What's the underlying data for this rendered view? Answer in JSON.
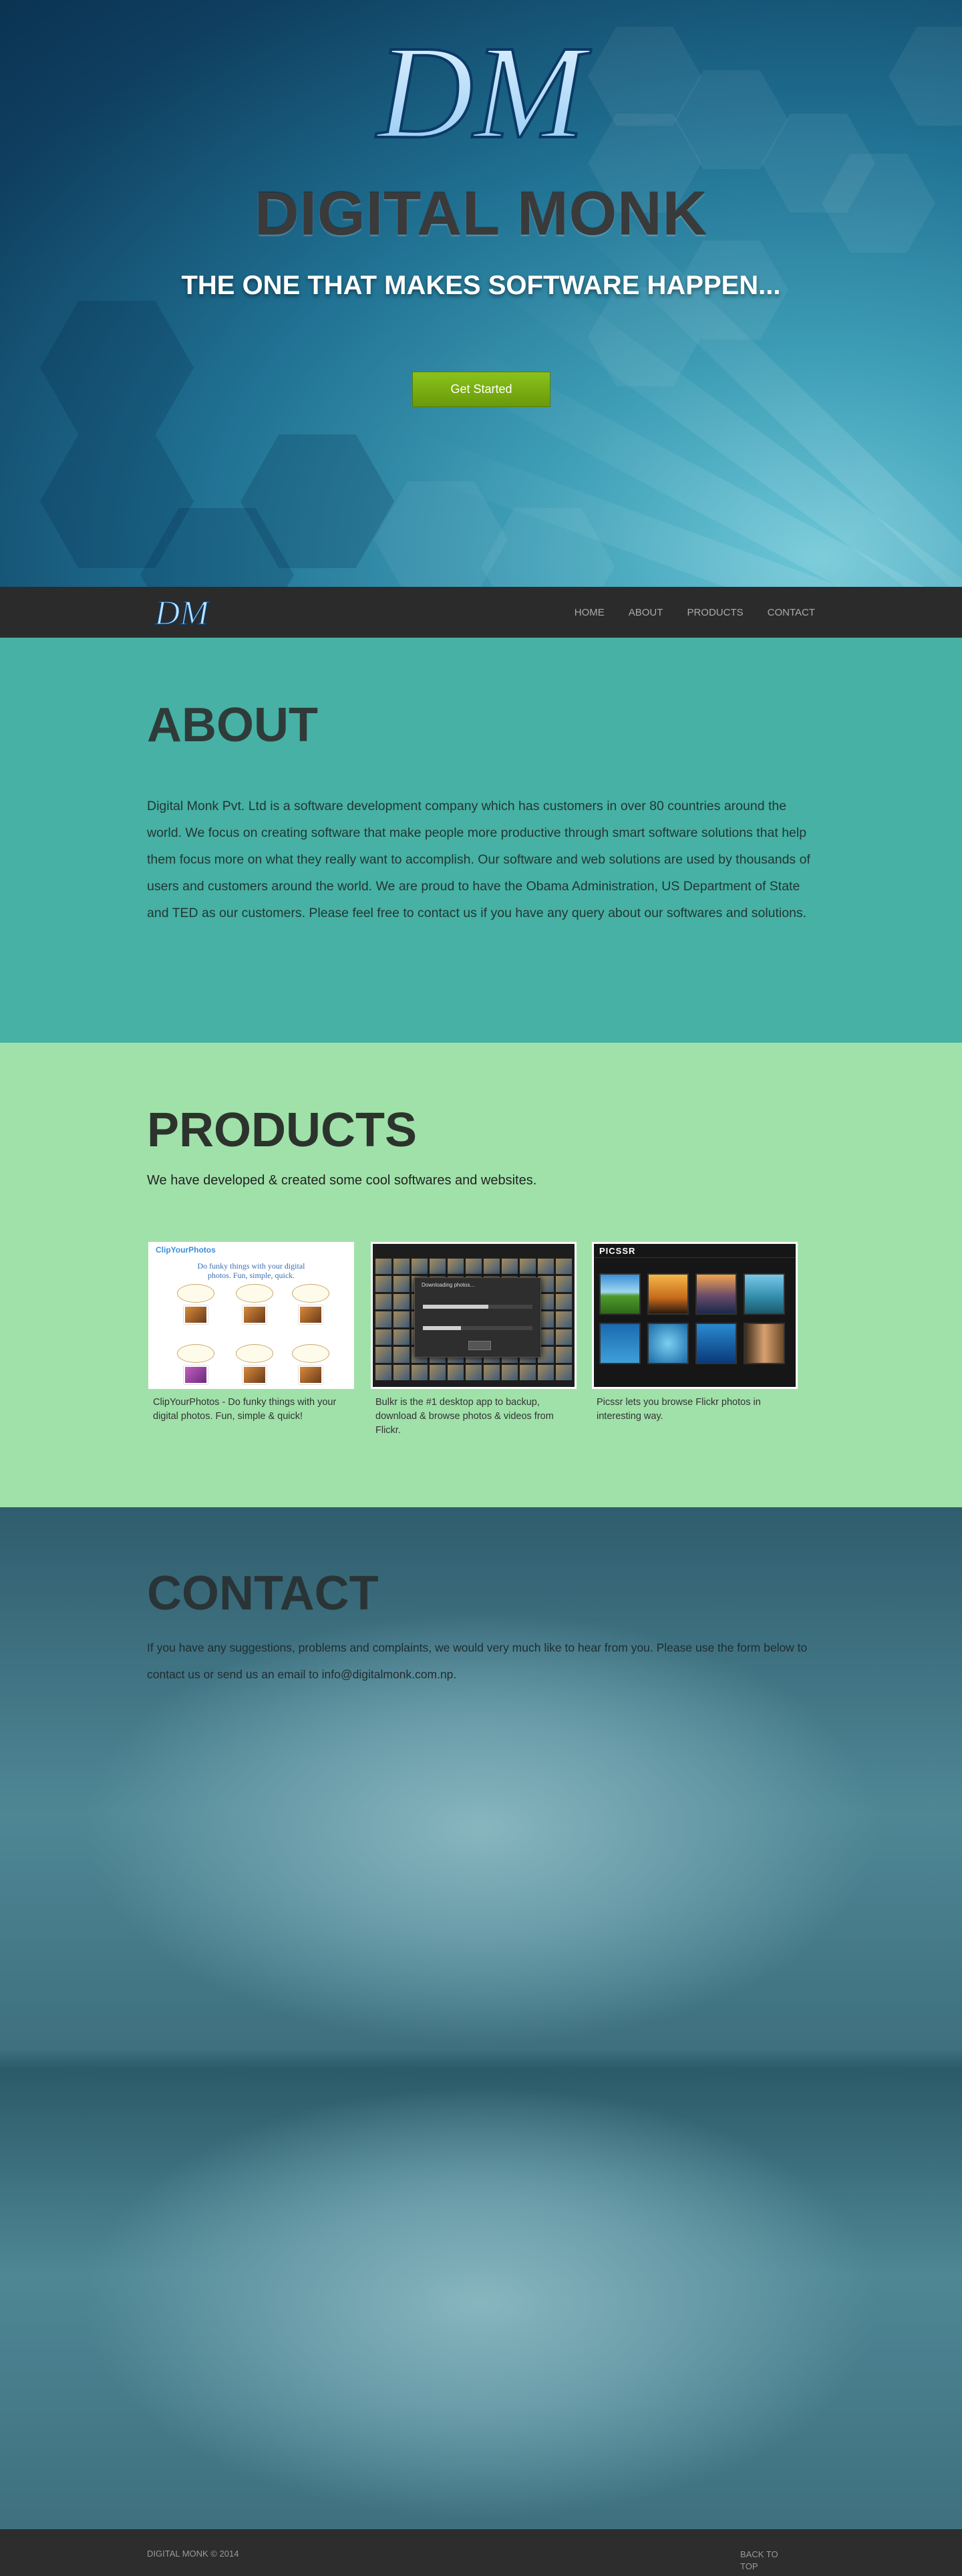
{
  "hero": {
    "logo_monogram": "DM",
    "title": "DIGITAL MONK",
    "tagline": "THE ONE THAT MAKES SOFTWARE HAPPEN...",
    "cta_label": "Get Started",
    "cta_color": "#7aae12"
  },
  "nav": {
    "logo_monogram": "DM",
    "items": [
      {
        "label": "HOME"
      },
      {
        "label": "ABOUT"
      },
      {
        "label": "PRODUCTS"
      },
      {
        "label": "CONTACT"
      }
    ]
  },
  "about": {
    "heading": "ABOUT",
    "body": "Digital Monk Pvt. Ltd is a software development company which has customers in over 80 countries around the world. We focus on creating software that make people more productive through smart software solutions that help them focus more on what they really want to accomplish. Our software and web solutions are used by thousands of users and customers around the world. We are proud to have the Obama Administration, US Department of State and TED as our customers. Please feel free to contact us if you have any query about our softwares and solutions."
  },
  "products": {
    "heading": "PRODUCTS",
    "subheading": "We have developed & created some cool softwares and websites.",
    "items": [
      {
        "caption": "ClipYourPhotos - Do funky things with your digital photos. Fun, simple & quick!",
        "thumb_brand": "ClipYourPhotos",
        "thumb_tagline": "Do funky things with your digital photos. Fun, simple, quick."
      },
      {
        "caption": "Bulkr is the #1 desktop app to backup, download & browse photos & videos from Flickr.",
        "thumb_title": "Downloading photos..."
      },
      {
        "caption": "Picssr lets you browse Flickr photos in interesting way.",
        "thumb_logo": "PICSSR"
      }
    ]
  },
  "contact": {
    "heading": "CONTACT",
    "body": "If you have any suggestions, problems and complaints, we would very much like to hear from you. Please use the form below to contact us or send us an email to info@digitalmonk.com.np."
  },
  "footer": {
    "copyright": "DIGITAL MONK © 2014",
    "back_to_top": "BACK TO TOP"
  },
  "colors": {
    "nav_bg": "#2b2b2b",
    "about_bg": "#46b1a4",
    "products_bg": "#a0e1a9",
    "footer_bg": "#2d2d2d"
  }
}
